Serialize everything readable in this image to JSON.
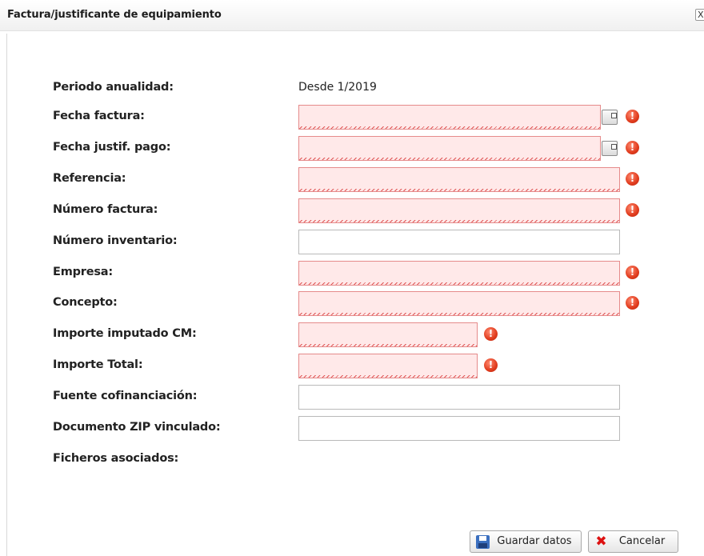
{
  "dialog": {
    "title": "Factura/justificante de equipamiento",
    "close_label": "X"
  },
  "form": {
    "periodo": {
      "label": "Periodo anualidad:",
      "value": "Desde 1/2019"
    },
    "fecha_factura": {
      "label": "Fecha factura:",
      "value": ""
    },
    "fecha_pago": {
      "label": "Fecha justif. pago:",
      "value": ""
    },
    "referencia": {
      "label": "Referencia:",
      "value": ""
    },
    "numero_factura": {
      "label": "Número factura:",
      "value": ""
    },
    "numero_inventario": {
      "label": "Número inventario:",
      "value": ""
    },
    "empresa": {
      "label": "Empresa:",
      "value": ""
    },
    "concepto": {
      "label": "Concepto:",
      "value": ""
    },
    "importe_cm": {
      "label": "Importe imputado CM:",
      "value": ""
    },
    "importe_total": {
      "label": "Importe Total:",
      "value": ""
    },
    "fuente": {
      "label": "Fuente cofinanciación:",
      "value": ""
    },
    "documento_zip": {
      "label": "Documento ZIP vinculado:",
      "value": ""
    },
    "ficheros": {
      "label": "Ficheros asociados:"
    }
  },
  "buttons": {
    "save": "Guardar datos",
    "cancel": "Cancelar"
  },
  "icons": {
    "error": "error-icon",
    "calendar": "calendar-icon"
  },
  "colors": {
    "invalid_bg": "#ffe9e9",
    "invalid_border": "#e58b8b",
    "error_icon": "#e03a1c"
  }
}
